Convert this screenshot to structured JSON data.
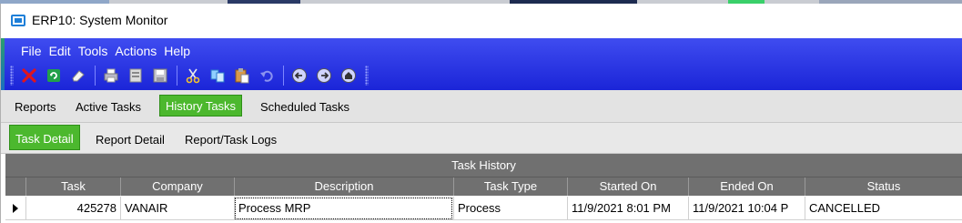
{
  "window": {
    "title": "ERP10: System Monitor"
  },
  "menu": [
    {
      "label": "File"
    },
    {
      "label": "Edit"
    },
    {
      "label": "Tools"
    },
    {
      "label": "Actions"
    },
    {
      "label": "Help"
    }
  ],
  "toolbar": {
    "buttons": [
      {
        "icon": "close-x-icon"
      },
      {
        "icon": "refresh-icon"
      },
      {
        "icon": "eraser-icon"
      },
      {
        "icon": "print-icon"
      },
      {
        "icon": "print-preview-icon"
      },
      {
        "icon": "save-icon"
      },
      {
        "icon": "cut-icon"
      },
      {
        "icon": "copy-icon"
      },
      {
        "icon": "paste-icon"
      },
      {
        "icon": "undo-icon"
      },
      {
        "icon": "back-icon"
      },
      {
        "icon": "forward-icon"
      },
      {
        "icon": "home-icon"
      }
    ]
  },
  "tabs": [
    {
      "label": "Reports",
      "active": false
    },
    {
      "label": "Active Tasks",
      "active": false
    },
    {
      "label": "History Tasks",
      "active": true
    },
    {
      "label": "Scheduled Tasks",
      "active": false
    }
  ],
  "subtabs": [
    {
      "label": "Task Detail",
      "active": true
    },
    {
      "label": "Report Detail",
      "active": false
    },
    {
      "label": "Report/Task Logs",
      "active": false
    }
  ],
  "grid": {
    "caption": "Task History",
    "columns": [
      "Task",
      "Company",
      "Description",
      "Task Type",
      "Started On",
      "Ended On",
      "Status"
    ],
    "rows": [
      {
        "task": "425278",
        "company": "VANAIR",
        "description": "Process MRP",
        "task_type": "Process",
        "started_on": "11/9/2021 8:01 PM",
        "ended_on": "11/9/2021 10:04 P",
        "status": "CANCELLED"
      }
    ]
  },
  "colors": {
    "accent_green": "#4cb82e",
    "app_blue": "#2a33e3",
    "grid_header": "#707070"
  }
}
